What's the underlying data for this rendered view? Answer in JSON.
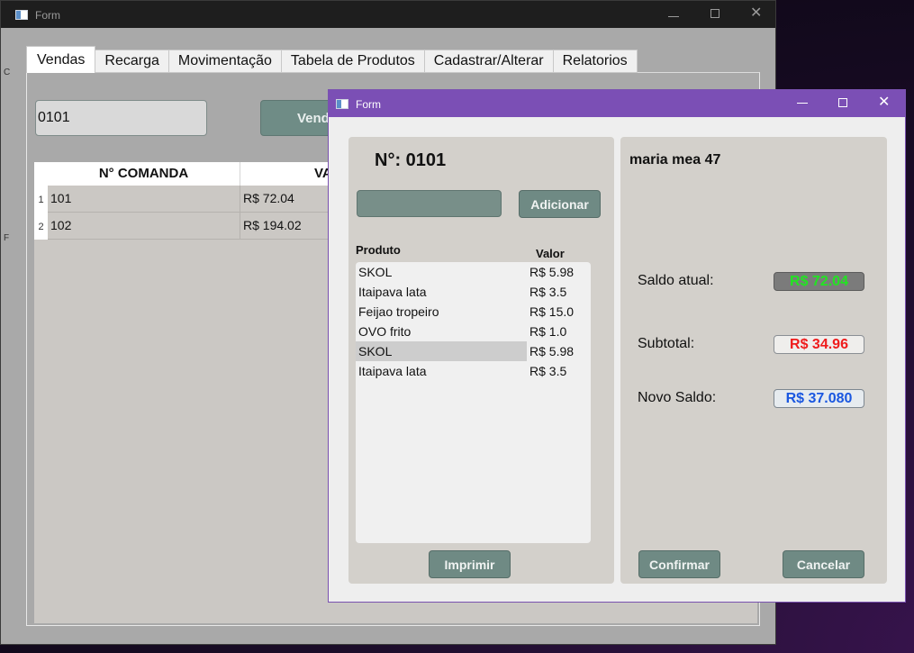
{
  "back_window": {
    "title": "Form",
    "tabs": [
      "Vendas",
      "Recarga",
      "Movimentação",
      "Tabela de Produtos",
      "Cadastrar/Alterar",
      "Relatorios"
    ],
    "comanda_input_value": "0101",
    "vender_button_label": "Vend",
    "table": {
      "col_num": "N° COMANDA",
      "col_val": "VA",
      "rows": [
        {
          "index": "1",
          "num": "101",
          "val": "R$  72.04"
        },
        {
          "index": "2",
          "num": "102",
          "val": "R$  194.02"
        }
      ]
    },
    "left_fragments": [
      "C",
      "F"
    ]
  },
  "front_window": {
    "title": "Form",
    "numero": "N°: 0101",
    "adicionar_label": "Adicionar",
    "produto_header": "Produto",
    "valor_header": "Valor",
    "items": [
      {
        "name": "SKOL",
        "value": "R$ 5.98"
      },
      {
        "name": "Itaipava lata",
        "value": "R$ 3.5"
      },
      {
        "name": "Feijao tropeiro",
        "value": "R$ 15.0"
      },
      {
        "name": "OVO  frito",
        "value": "R$ 1.0"
      },
      {
        "name": "SKOL",
        "value": "R$ 5.98"
      },
      {
        "name": "Itaipava lata",
        "value": "R$ 3.5"
      }
    ],
    "selected_item_index": 4,
    "imprimir_label": "Imprimir",
    "cliente": "maria mea 47",
    "saldo_atual_label": "Saldo atual:",
    "saldo_atual_value": "R$ 72.04",
    "subtotal_label": "Subtotal:",
    "subtotal_value": "R$ 34.96",
    "novo_saldo_label": "Novo Saldo:",
    "novo_saldo_value": "R$ 37.080",
    "confirmar_label": "Confirmar",
    "cancelar_label": "Cancelar"
  },
  "colors": {
    "front_titlebar": "#7b4fb5",
    "button": "#6f8a84",
    "saldo_text": "#22e422",
    "subtotal_text": "#ef1c1c",
    "novo_saldo_text": "#1a57e0"
  }
}
